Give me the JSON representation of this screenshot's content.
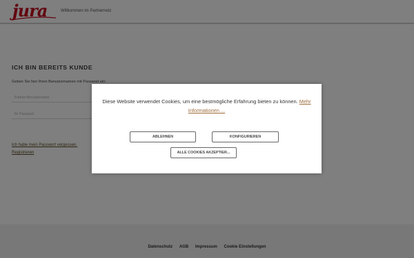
{
  "header": {
    "logo_text": "jura",
    "welcome": "Willkommen im Partnernetz"
  },
  "login": {
    "title": "ICH BIN BEREITS KUNDE",
    "intro": "Geben Sie hier Ihren Benutzernamen mit Passwort ein:",
    "username_placeholder": "Partner-Benutzername",
    "password_placeholder": "Ihr Passwort",
    "forgot_link": "Ich habe mein Passwort vergessen.",
    "register_link": "Registrieren"
  },
  "cookie_banner": {
    "message": "Diese Website verwendet Cookies, um eine bestmögliche Erfahrung bieten zu können.",
    "more_info": "Mehr Informationen ...",
    "reject_label": "ABLEHNEN",
    "configure_label": "KONFIGURIEREN",
    "accept_all_label": "ALLE COOKIES AKZEPTIER..."
  },
  "footer": {
    "links": [
      "Datenschutz",
      "AGB",
      "Impressum",
      "Cookie Einstellungen"
    ]
  },
  "colors": {
    "brand": "#c40d1e",
    "link": "#9e6c3a",
    "overlay": "rgba(0,0,0,0.5)"
  }
}
